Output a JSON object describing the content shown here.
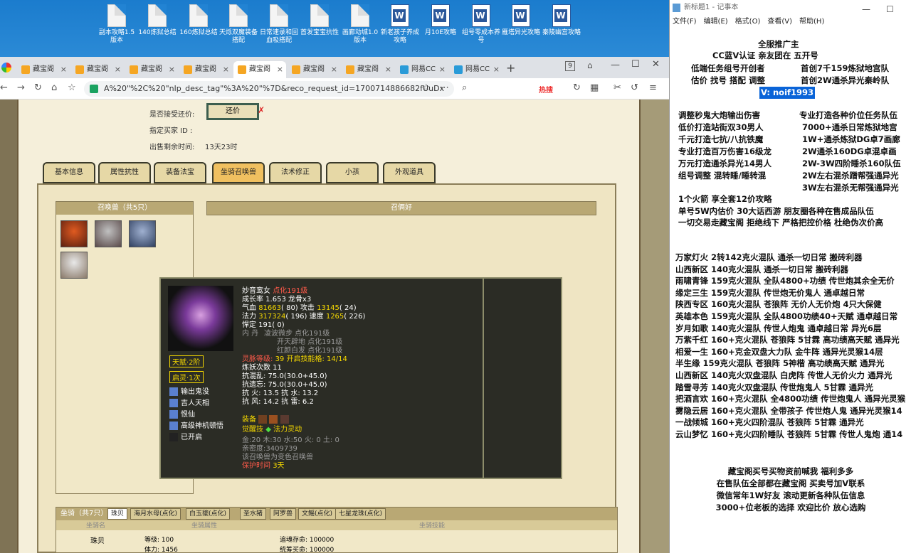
{
  "desktop": {
    "icons": [
      {
        "label": "副本攻略1.5版本",
        "type": "file"
      },
      {
        "label": "140炼狱总结",
        "type": "file"
      },
      {
        "label": "160炼狱总结",
        "type": "file"
      },
      {
        "label": "天烁双魔装备搭配",
        "type": "file"
      },
      {
        "label": "日常速录和回血吸搭配",
        "type": "file"
      },
      {
        "label": "首发宝宝抗性",
        "type": "file"
      },
      {
        "label": "画廊动城1.0版本",
        "type": "file"
      },
      {
        "label": "新老孩子养成攻略",
        "type": "word"
      },
      {
        "label": "月10E攻略",
        "type": "word"
      },
      {
        "label": "组号零成本养号",
        "type": "word"
      },
      {
        "label": "雁塔异光攻略",
        "type": "word"
      },
      {
        "label": "秦陵幽宫攻略",
        "type": "word"
      }
    ]
  },
  "browser": {
    "tabs": [
      {
        "label": "藏宝阁"
      },
      {
        "label": "藏宝阁"
      },
      {
        "label": "藏宝阁"
      },
      {
        "label": "藏宝阁"
      },
      {
        "label": "藏宝阁",
        "active": true
      },
      {
        "label": "藏宝阁"
      },
      {
        "label": "藏宝阁"
      },
      {
        "label": "网易CC"
      },
      {
        "label": "网易CC"
      }
    ],
    "tab_count": "9",
    "url": "A%20\"%2C%20\"nlp_desc_tag\"%3A%20\"%7D&reco_request_id=1700714886682fUuDx",
    "hot_label": "热搜"
  },
  "game": {
    "accept_offer_label": "是否接受还价:",
    "offer_button": "还价",
    "buyer_id_label": "指定买家 ID :",
    "remaining_label": "出售剩余时间:",
    "remaining_value": "13天23时",
    "tabs": [
      "基本信息",
      "属性抗性",
      "装备法宝",
      "坐骑召唤兽",
      "法术修正",
      "小孩",
      "外观道具"
    ],
    "active_tab": "坐骑召唤兽",
    "summon_title": "召唤兽（共5只）",
    "pet_name_title": "召俩好",
    "mount_title": "坐骑（共7只）",
    "mount_tabs": [
      "珠贝",
      "海月水母(点化)",
      "白玉貔(点化)",
      "圣水猪",
      "阿罗兽",
      "文鳐(点化)",
      "七星龙珠(点化)"
    ],
    "mount_headers": [
      "坐骑名",
      "坐骑属性",
      "坐骑技能"
    ],
    "mount_row": {
      "name": "珠贝",
      "level": "等级: 100",
      "stamina": "体力: 1456",
      "life": "追魂存命: 100000",
      "exp": "统筹买命: 100000"
    }
  },
  "pet_popup": {
    "name": "妙音鸾女",
    "name_suffix": "点化191级",
    "growth": "成长率 1.653 龙骨x3",
    "hp": "气血 81663( 80) 攻击 13145( 24)",
    "mp": "法力 317324( 196) 速度 1265( 226)",
    "hp_name": "气血",
    "hp_val": "81663",
    "hp_pt": "( 80)",
    "atk_name": "攻击",
    "atk_val": "13145",
    "atk_pt": "( 24)",
    "mp_name": "法力",
    "mp_val": "317324",
    "mp_pt": "( 196)",
    "spd_name": "速度",
    "spd_val": "1265",
    "spd_pt": "( 226)",
    "def": "悍定 191( 0)",
    "inner_title": "内  丹",
    "inner": [
      "凌波微步 点化191级",
      "开天辟地 点化191级",
      "红颜白发 点化191级"
    ],
    "soul_label": "灵脉等级:",
    "soul_value": "39 开启技能格: 14/14",
    "refine": "炼妖次数 11",
    "resist_seal": "抗混乱: 75.0(30.0+45.0)",
    "resist_forget": "抗遗忘: 75.0(30.0+45.0)",
    "resist_fire": "抗  火: 13.5 抗  水: 13.2",
    "resist_wind": "抗  风: 14.2 抗  雷: 6.2",
    "equip_label": "装备",
    "awaken_label": "觉醒技",
    "awaken_value": "法力灵动",
    "elements": "金:20 木:30 水:50 火: 0 土: 0",
    "intimacy": "亲密度:3409739",
    "transform": "该召唤兽为变色召唤兽",
    "protect_label": "保护时间",
    "protect_value": "3天",
    "talent": "天赋·2阶",
    "spirit": "启灵·1次",
    "skills": [
      "输出鬼没",
      "吉人天相",
      "恨仙",
      "高级神机顿悟",
      "已开启"
    ]
  },
  "notepad": {
    "title": "新标题1 - 记事本",
    "menu": [
      "文件(F)",
      "编辑(E)",
      "格式(O)",
      "查看(V)",
      "帮助(H)"
    ],
    "header_lines": [
      "全服推广主",
      "CC蓝V认证 亲友团在 五开号",
      "低端任务组号开创者",
      "首创7千159炼狱地宫队",
      "估价 找号 搭配 调整",
      "首创2W通杀异光秦岭队"
    ],
    "contact": "V:  noif1993",
    "services": [
      [
        "调整秒鬼大炮输出伤害",
        "专业打造各种价位任务队伍"
      ],
      [
        "低价打造站街双30男人",
        "7000+通杀日常炼狱地宫"
      ],
      [
        "千元打造七抗/八抗铁魔",
        "1W+通杀炼狱DG卓7画廊"
      ],
      [
        "专业打造百万伤害16级龙",
        "2W通杀160DG卓混卓画"
      ],
      [
        "万元打造通杀异光14男人",
        "2W-3W四阶睡杀160队伍"
      ],
      [
        "组号调整 混转睡/睡转混",
        "2W左右混杀蹭帮强通异光"
      ],
      [
        "",
        "3W左右混杀无帮强通异光"
      ]
    ],
    "mid_lines": [
      "1个火箭 享全套12价攻略",
      "单号5W内估价 30大话西游        朋友圈各种在售成品队伍",
      "一切交易走藏宝阁 拒绝线下      严格把控价格 杜绝伪次价高"
    ],
    "teams": [
      "万家灯火 2转142克火混队 通杀一切日常 搬砖利器",
      "山西新区 140克火混队 通杀一切日常 搬砖利器",
      "雨啸青锋 159克火混队 全队4800+功绩 传世炮其余全无价",
      "缘定三生 159克火混队 传世炮无价鬼人 通卓越日常",
      "陕西专区 160克火混队 苍狼阵 无价人无价炮 4只大保健",
      "英雄本色 159克火混队 全队4800功绩40+天赋 通卓越日常",
      "岁月如歌 140克火混队 传世人炮鬼 通卓越日常 异光6层",
      "万紫千红 160+克火混队 苍狼阵 5甘霖 高功绩高天赋 通异光",
      "相爱一生 160+克金双盘大力队 金牛阵 通异光灵猴14层",
      "半生缘    159克火混队 苍狼阵 5神楷 高功绩高天赋 通异光",
      "山西新区 140克火双盘混队 白虎阵 传世人无价火力 通异光",
      "踏雪寻芳 140克火双盘混队 传世炮鬼人 5甘霖 通异光",
      "把酒言欢 160+克火混队 全4800功绩 传世炮鬼人 通异光灵猴",
      "雾隐云居 160+克火混队 全带孩子 传世炮人鬼 通异光灵猴14",
      "一战倾城 160+克火四阶混队 苍狼阵 5甘霖 通异光",
      "云山梦忆 160+克火四阶睡队 苍狼阵 5甘霖 传世人鬼炮 通14"
    ],
    "footer": [
      "藏宝阁买号买物资前喊我 福利多多",
      "在售队伍全部都在藏宝阁 买卖号加V联系",
      "微信常年1W好友 滚动更新各种队伍信息",
      "3000+位老板的选择 欢迎比价 放心选购"
    ]
  },
  "colors": {
    "accent_red": "#ff5a4a",
    "accent_yellow": "#f5d800",
    "highlight": "#0a64d8"
  }
}
